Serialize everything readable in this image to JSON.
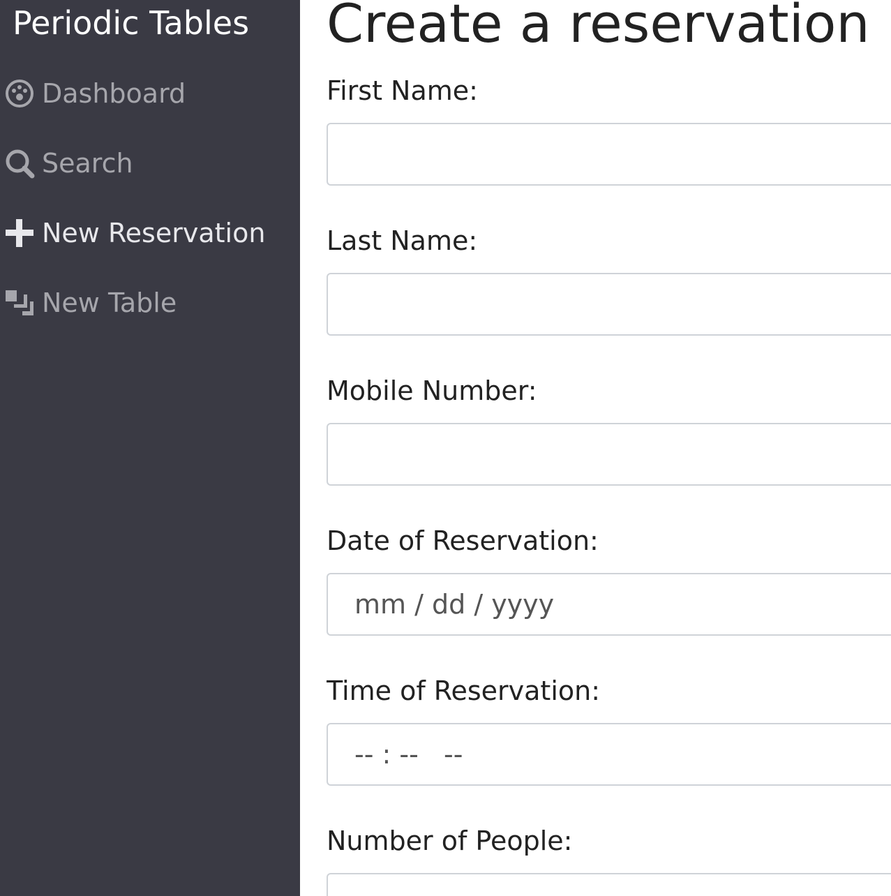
{
  "sidebar": {
    "brand": "Periodic Tables",
    "items": [
      {
        "label": "Dashboard",
        "icon": "dashboard-icon"
      },
      {
        "label": "Search",
        "icon": "search-icon"
      },
      {
        "label": "New Reservation",
        "icon": "plus-icon"
      },
      {
        "label": "New Table",
        "icon": "layers-icon"
      }
    ],
    "bg_color": "#3a3a44"
  },
  "main": {
    "title": "Create a reservation",
    "fields": {
      "first_name": {
        "label": "First Name:",
        "value": "",
        "placeholder": ""
      },
      "last_name": {
        "label": "Last Name:",
        "value": "",
        "placeholder": ""
      },
      "mobile_number": {
        "label": "Mobile Number:",
        "value": "",
        "placeholder": ""
      },
      "date": {
        "label": "Date of Reservation:",
        "placeholder": "mm / dd / yyyy"
      },
      "time": {
        "label": "Time of Reservation:",
        "placeholder": "-- : --   --"
      },
      "people": {
        "label": "Number of People:",
        "value": ""
      }
    }
  }
}
